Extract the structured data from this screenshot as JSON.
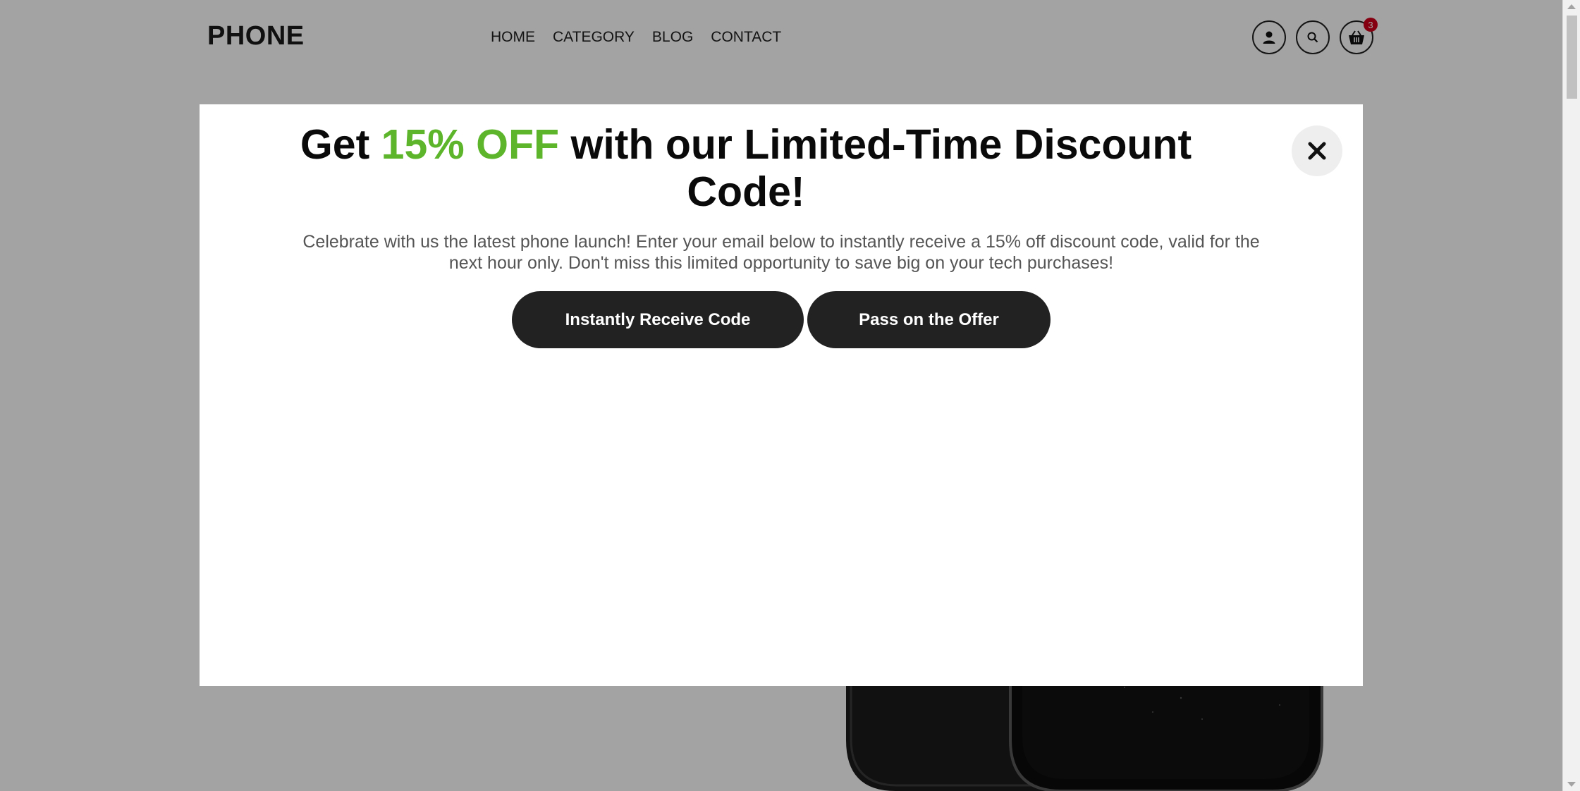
{
  "header": {
    "logo": "PHONE",
    "nav": [
      "HOME",
      "CATEGORY",
      "BLOG",
      "CONTACT"
    ],
    "cart_count": "3",
    "icons": [
      "user-icon",
      "search-icon",
      "cart-icon"
    ]
  },
  "modal": {
    "headline_pre": "Get ",
    "headline_accent": "15% OFF",
    "headline_post": " with our Limited-Time Discount Code!",
    "description": "Celebrate with us the latest phone launch! Enter your email below to instantly receive a 15% off discount code, valid for the next hour only. Don't miss this limited opportunity to save big on your tech purchases!",
    "primary_button": "Instantly Receive Code",
    "secondary_button": "Pass on the Offer",
    "accent_color": "#5cb52a",
    "button_color": "#222222"
  }
}
